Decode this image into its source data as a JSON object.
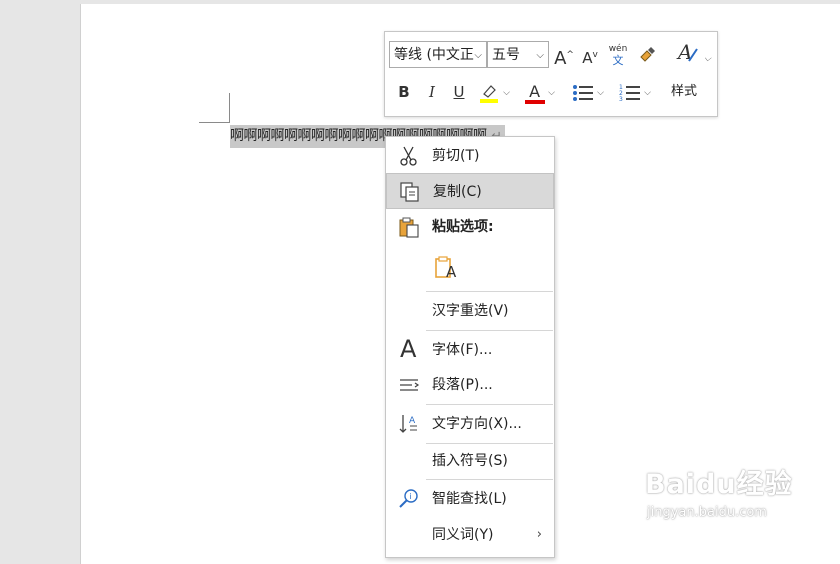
{
  "document": {
    "selected_text": "啊啊啊啊啊啊啊啊啊啊啊啊啊啊啊啊啊啊啊",
    "paragraph_mark": "↵"
  },
  "mini_toolbar": {
    "font_name": "等线 (中文正",
    "font_size": "五号",
    "bold": "B",
    "italic": "I",
    "underline": "U",
    "font_color_letter": "A",
    "grow_font": "A",
    "shrink_font": "A",
    "phonetic_top": "wén",
    "phonetic_bottom": "文",
    "styles_label": "样式",
    "highlight_color": "#ffff00",
    "font_color": "#e00000"
  },
  "context_menu": {
    "items": [
      {
        "label": "剪切(T)",
        "icon": "scissors-icon"
      },
      {
        "label": "复制(C)",
        "icon": "copy-icon",
        "highlighted": true
      },
      {
        "label": "粘贴选项:",
        "icon": "paste-icon"
      },
      {
        "label": "汉字重选(V)",
        "icon": ""
      },
      {
        "label": "字体(F)...",
        "icon": "font-icon"
      },
      {
        "label": "段落(P)...",
        "icon": "paragraph-icon"
      },
      {
        "label": "文字方向(X)...",
        "icon": "text-direction-icon"
      },
      {
        "label": "插入符号(S)",
        "icon": ""
      },
      {
        "label": "智能查找(L)",
        "icon": "smart-lookup-icon"
      },
      {
        "label": "同义词(Y)",
        "icon": "",
        "submenu": true
      }
    ],
    "paste_keep_text": "A"
  },
  "watermark": {
    "brand": "Baidu经验",
    "url": "jingyan.baidu.com"
  }
}
